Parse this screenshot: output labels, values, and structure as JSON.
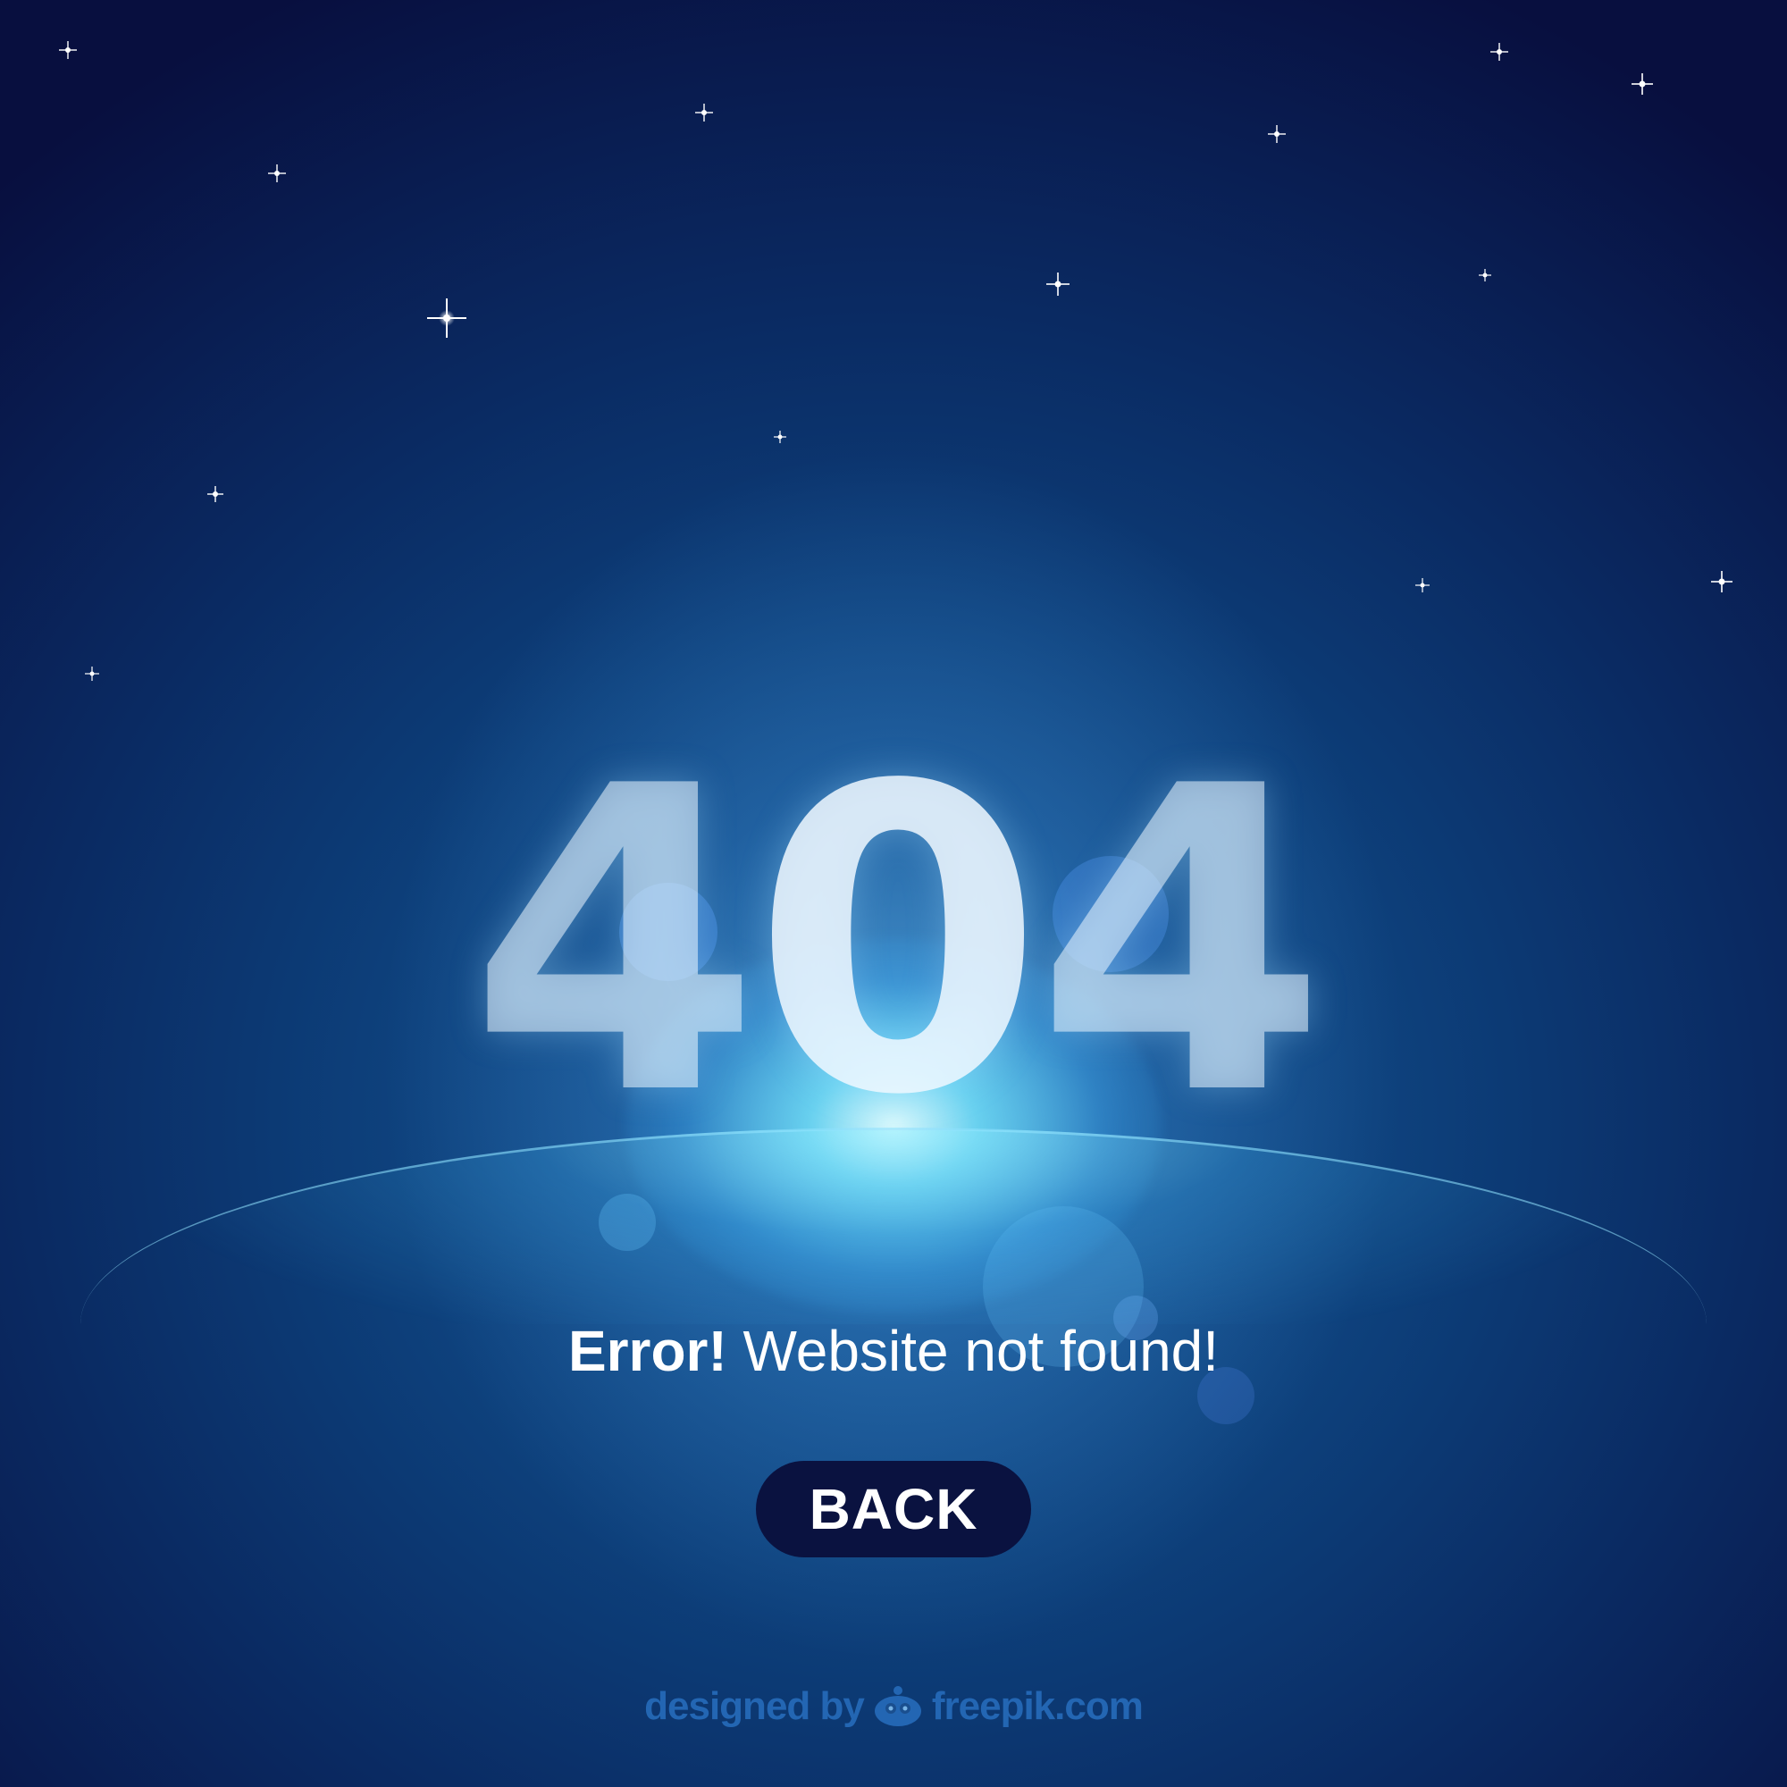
{
  "error_page": {
    "code_parts": [
      "4",
      "0",
      "4"
    ],
    "message_strong": "Error!",
    "message_rest": "Website not found!",
    "back_label": "BACK"
  },
  "credit": {
    "prefix": "designed by",
    "brand": "freepik.com",
    "icon": "freepik-mascot-icon"
  },
  "colors": {
    "sky_dark": "#080f3f",
    "sky_mid": "#0d3f7a",
    "glow": "#8fe9ff",
    "button_bg": "#0a1240",
    "credit_text": "#286ebe"
  }
}
